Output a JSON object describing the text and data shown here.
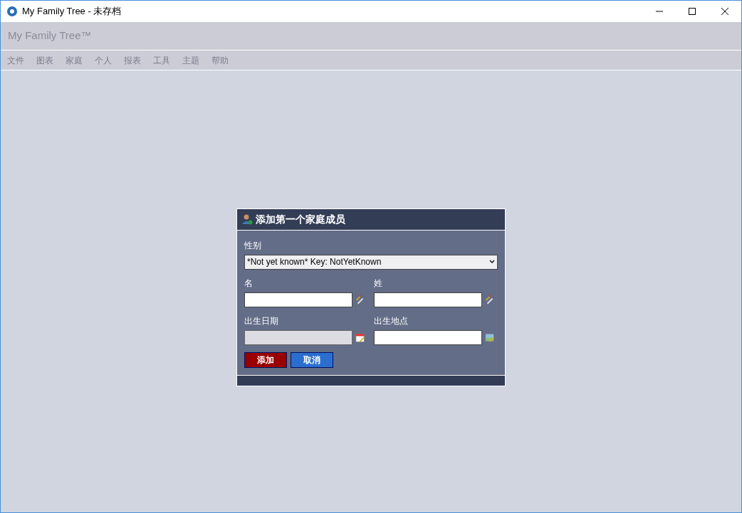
{
  "window": {
    "title": "My Family Tree - 未存档"
  },
  "app_header": {
    "title": "My Family Tree™"
  },
  "menu": [
    {
      "label": "文件",
      "disabled": true
    },
    {
      "label": "图表",
      "disabled": true
    },
    {
      "label": "家庭",
      "disabled": true
    },
    {
      "label": "个人",
      "disabled": true
    },
    {
      "label": "报表",
      "disabled": true
    },
    {
      "label": "工具",
      "disabled": true
    },
    {
      "label": "主题",
      "disabled": true
    },
    {
      "label": "帮助",
      "disabled": true
    }
  ],
  "dialog": {
    "title": "添加第一个家庭成员",
    "gender": {
      "label": "性别",
      "value": "*Not yet known* Key: NotYetKnown"
    },
    "fields": [
      {
        "label": "名",
        "kind": "text",
        "disabled": false
      },
      {
        "label": "姓",
        "kind": "text",
        "disabled": false
      },
      {
        "label": "出生日期",
        "kind": "date",
        "disabled": true
      },
      {
        "label": "出生地点",
        "kind": "place",
        "disabled": false
      }
    ],
    "buttons": [
      {
        "label": "添加",
        "kind": "primary"
      },
      {
        "label": "取消",
        "kind": "secondary"
      }
    ]
  }
}
